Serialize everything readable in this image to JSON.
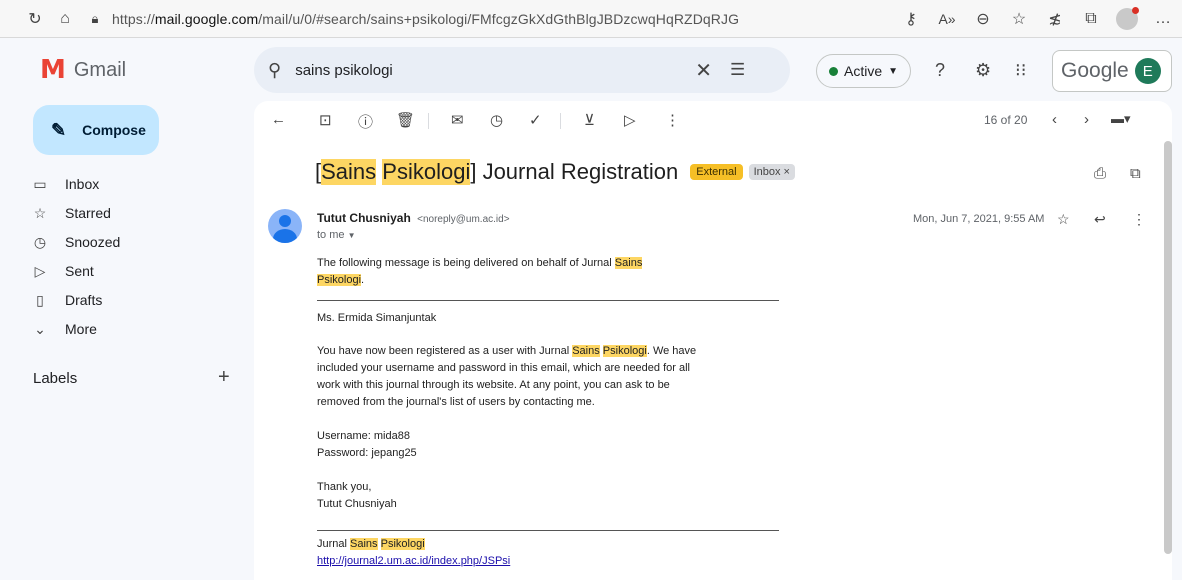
{
  "browser": {
    "url_prefix": "https://",
    "url_domain": "mail.google.com",
    "url_path": "/mail/u/0/#search/sains+psikologi/FMfcgzGkXdGthBlgJBDzcwqHqRZDqRJG"
  },
  "header": {
    "app_name": "Gmail",
    "search_value": "sains psikologi",
    "status": "Active",
    "brand": "Google",
    "avatar_initial": "E"
  },
  "sidebar": {
    "compose": "Compose",
    "items": [
      {
        "label": "Inbox",
        "icon": "inbox-icon"
      },
      {
        "label": "Starred",
        "icon": "star-icon"
      },
      {
        "label": "Snoozed",
        "icon": "clock-icon"
      },
      {
        "label": "Sent",
        "icon": "send-icon"
      },
      {
        "label": "Drafts",
        "icon": "file-icon"
      },
      {
        "label": "More",
        "icon": "chevron-down-icon"
      }
    ],
    "labels_title": "Labels"
  },
  "toolbar": {
    "pager": "16 of 20"
  },
  "email": {
    "subject_open": "[",
    "subject_hl1": "Sains",
    "subject_hl2": "Psikologi",
    "subject_rest": "] Journal Registration",
    "tag_external": "External",
    "tag_inbox": "Inbox ×",
    "sender_name": "Tutut Chusniyah",
    "sender_email": "<noreply@um.ac.id>",
    "to": "to me",
    "date": "Mon, Jun 7, 2021, 9:55 AM",
    "intro_line1": "The following message is being delivered on behalf of Jurnal",
    "hl_sains": "Sains",
    "hl_psikologi": "Psikologi",
    "intro_end": ".",
    "greeting": "Ms. Ermida Simanjuntak",
    "p1_line1_a": "You have now been registered as a user with Jurnal",
    "p1_line1_b": ". We have",
    "p1_line2": "included your username and password in this email, which are needed for all",
    "p1_line3": "work with this journal through its website. At any point, you can ask to be",
    "p1_line4": "removed from the journal's list of users by contacting me.",
    "username": "Username: mida88",
    "password": "Password: jepang25",
    "thanks": "Thank you,",
    "signoff": "Tutut Chusniyah",
    "footer_prefix": "Jurnal",
    "footer_link": "http://journal2.um.ac.id/index.php/JSPsi"
  }
}
